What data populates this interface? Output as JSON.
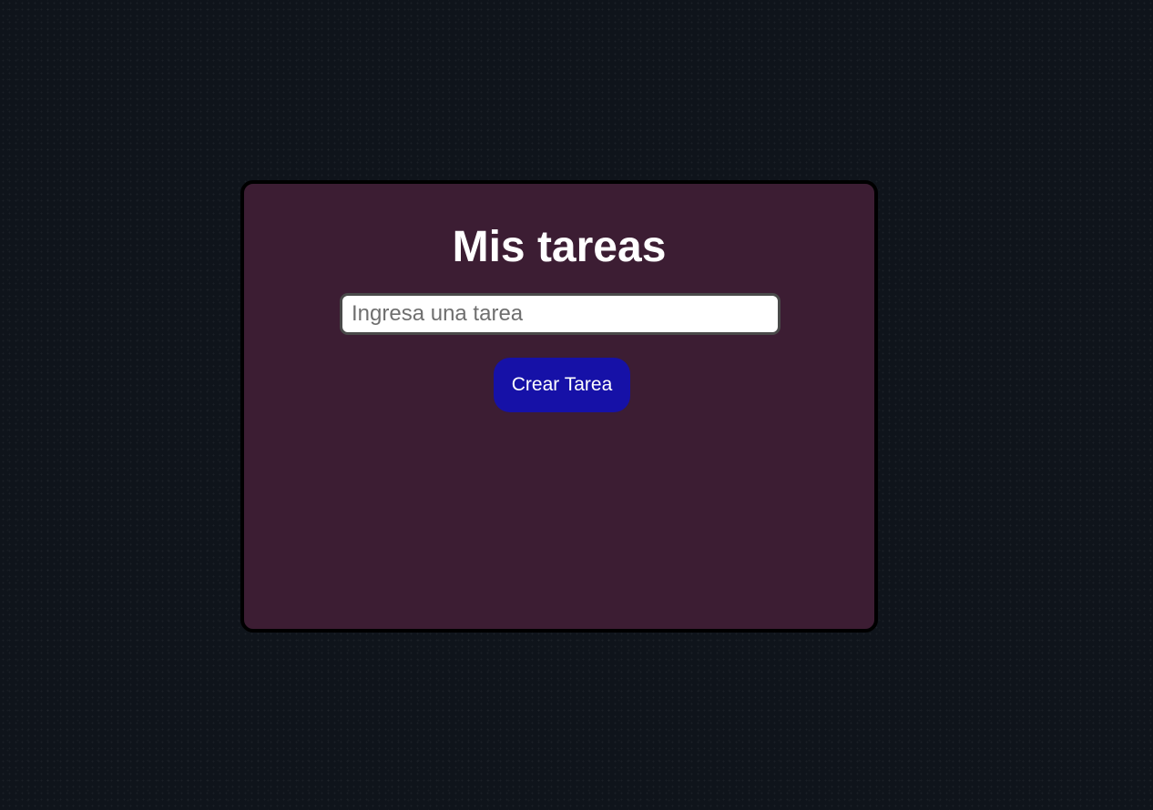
{
  "app": {
    "title": "Mis tareas"
  },
  "task_form": {
    "input_value": "",
    "input_placeholder": "Ingresa una tarea",
    "create_label": "Crear Tarea"
  },
  "colors": {
    "background": "#0f141b",
    "card": "#3c1d33",
    "card_border": "#000000",
    "button": "#1611a7",
    "title_text": "#ffffff"
  }
}
